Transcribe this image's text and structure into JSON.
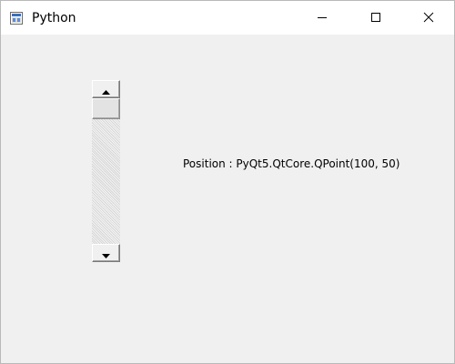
{
  "window": {
    "title": "Python",
    "icons": {
      "app": "python-app-icon",
      "minimize": "minimize-icon",
      "maximize": "maximize-icon",
      "close": "close-icon"
    }
  },
  "scrollbar": {
    "orientation": "vertical",
    "value_fraction": 0.0,
    "up_icon": "triangle-up-icon",
    "down_icon": "triangle-down-icon"
  },
  "label": {
    "text": "Position : PyQt5.QtCore.QPoint(100, 50)"
  },
  "colors": {
    "client_background": "#f0f0f0",
    "titlebar_background": "#ffffff",
    "text": "#000000"
  }
}
